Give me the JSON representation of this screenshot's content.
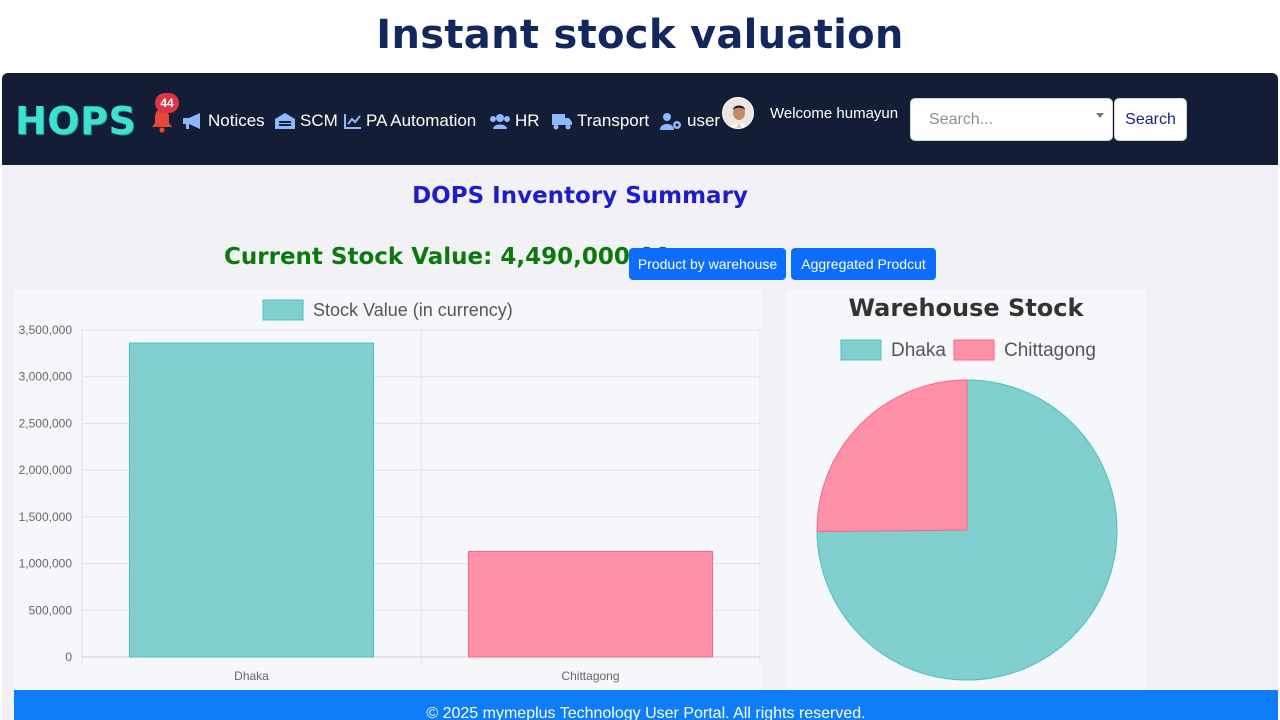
{
  "slide_title": "Instant stock valuation",
  "navbar": {
    "brand": "HOPS",
    "notification_count": "44",
    "items": [
      {
        "label": "Notices",
        "icon": "bullhorn-icon"
      },
      {
        "label": "SCM",
        "icon": "warehouse-icon"
      },
      {
        "label": "PA Automation",
        "icon": "chart-line-icon"
      },
      {
        "label": "HR",
        "icon": "users-icon"
      },
      {
        "label": "Transport",
        "icon": "truck-icon"
      },
      {
        "label": "user",
        "icon": "user-gear-icon"
      }
    ],
    "welcome": "Welcome humayun",
    "search_placeholder": "Search...",
    "search_button": "Search"
  },
  "main": {
    "heading": "DOPS Inventory Summary",
    "stock_value_text": "Current Stock Value: 4,490,000.00",
    "buttons": {
      "product_by_warehouse": "Product by warehouse",
      "aggregated_product": "Aggregated Prodcut"
    }
  },
  "colors": {
    "navbar": "#141d36",
    "brand": "#40e0d0",
    "teal_fill": "#82cfd0",
    "teal_stroke": "#4bc0c0",
    "pink_fill": "#fe90a7",
    "pink_stroke": "#ff6384",
    "heading": "#1c1fc9",
    "stock_value": "#0b7a0b",
    "button": "#0d6efd",
    "footer": "#0d7df8"
  },
  "chart_data": [
    {
      "type": "bar",
      "legend": "Stock Value (in currency)",
      "categories": [
        "Dhaka",
        "Chittagong"
      ],
      "values": [
        3360000,
        1130000
      ],
      "ylim": [
        0,
        3500000
      ],
      "yticks": [
        "0",
        "500,000",
        "1,000,000",
        "1,500,000",
        "2,000,000",
        "2,500,000",
        "3,000,000",
        "3,500,000"
      ],
      "grid": true,
      "legend_position": "top"
    },
    {
      "type": "pie",
      "title": "Warehouse Stock",
      "labels": [
        "Dhaka",
        "Chittagong"
      ],
      "values": [
        3360000,
        1130000
      ],
      "legend_position": "top"
    }
  ],
  "footer": "© 2025 mymeplus Technology User Portal. All rights reserved."
}
